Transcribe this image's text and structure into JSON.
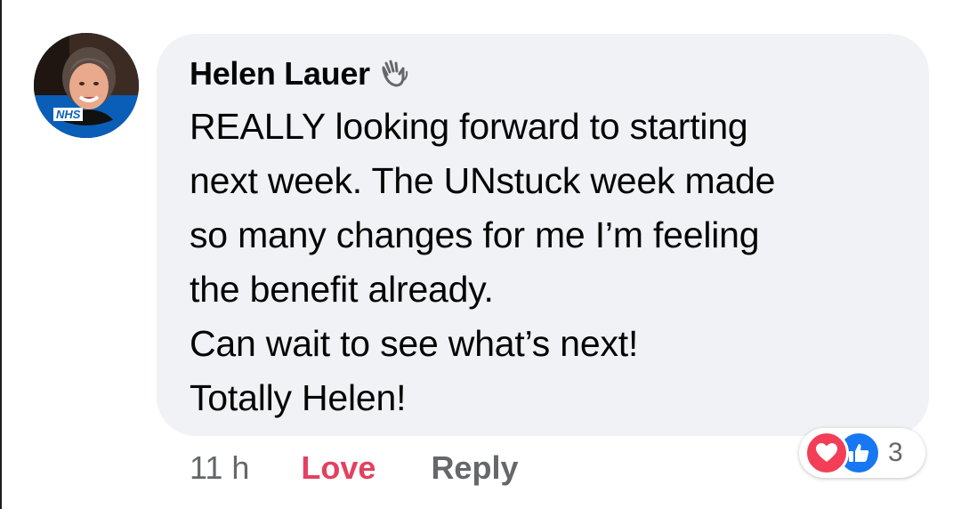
{
  "comment": {
    "author": "Helen Lauer",
    "author_badge_icon": "waving-hand-icon",
    "avatar": {
      "badge_text": "NHS",
      "frame_color": "#0a5eb8"
    },
    "lines": [
      "REALLY looking forward to starting",
      "next week. The UNstuck week made",
      "so many changes for me I’m feeling",
      "the benefit already.",
      "Can wait to see what’s next!",
      "Totally Helen!"
    ]
  },
  "actions": {
    "timestamp": "11 h",
    "love_label": "Love",
    "reply_label": "Reply"
  },
  "reactions": {
    "icons": [
      "love-reaction-icon",
      "like-reaction-icon"
    ],
    "count": "3",
    "love_color": "#f33e58",
    "like_color": "#1877f2"
  },
  "colors": {
    "bubble": "#f0f2f5",
    "text": "#050505",
    "secondary": "#65676b",
    "love": "#e4405f"
  }
}
